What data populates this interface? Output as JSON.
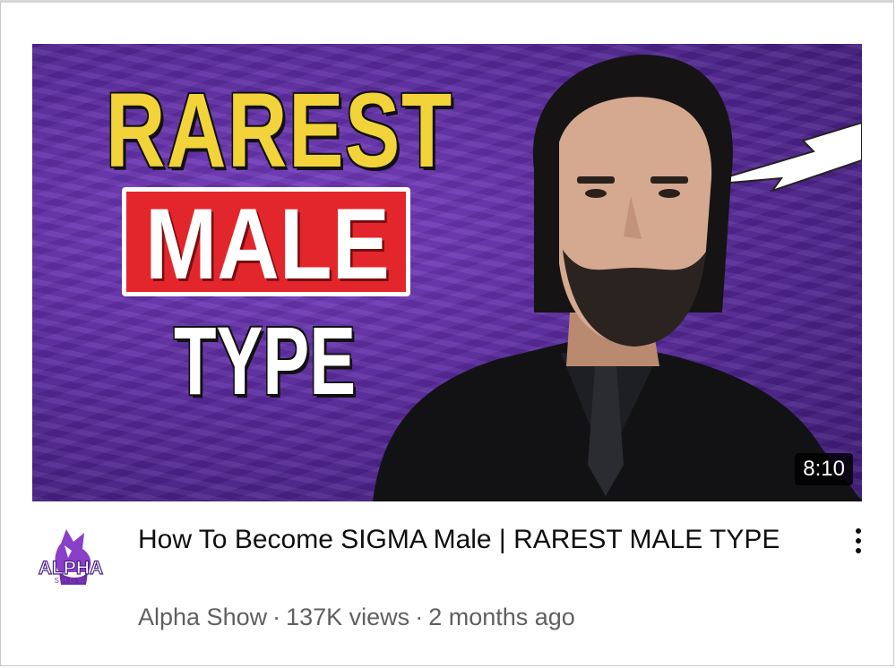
{
  "video": {
    "thumbnail": {
      "line1": "RAREST",
      "line2": "MALE",
      "line3": "TYPE",
      "duration": "8:10",
      "colors": {
        "background": "#5a2a9e",
        "line1": "#f2d33a",
        "line2_box": "#e3262b",
        "text_white": "#ffffff"
      }
    },
    "channel": {
      "avatar_icon": "wolf-logo-icon",
      "avatar_text": "ALPHA",
      "avatar_subtext": "SHOW",
      "name": "Alpha Show"
    },
    "title": "How To Become SIGMA Male | RAREST MALE TYPE",
    "views": "137K views",
    "age": "2 months ago",
    "separator": "·",
    "menu_icon": "kebab-menu-icon"
  }
}
